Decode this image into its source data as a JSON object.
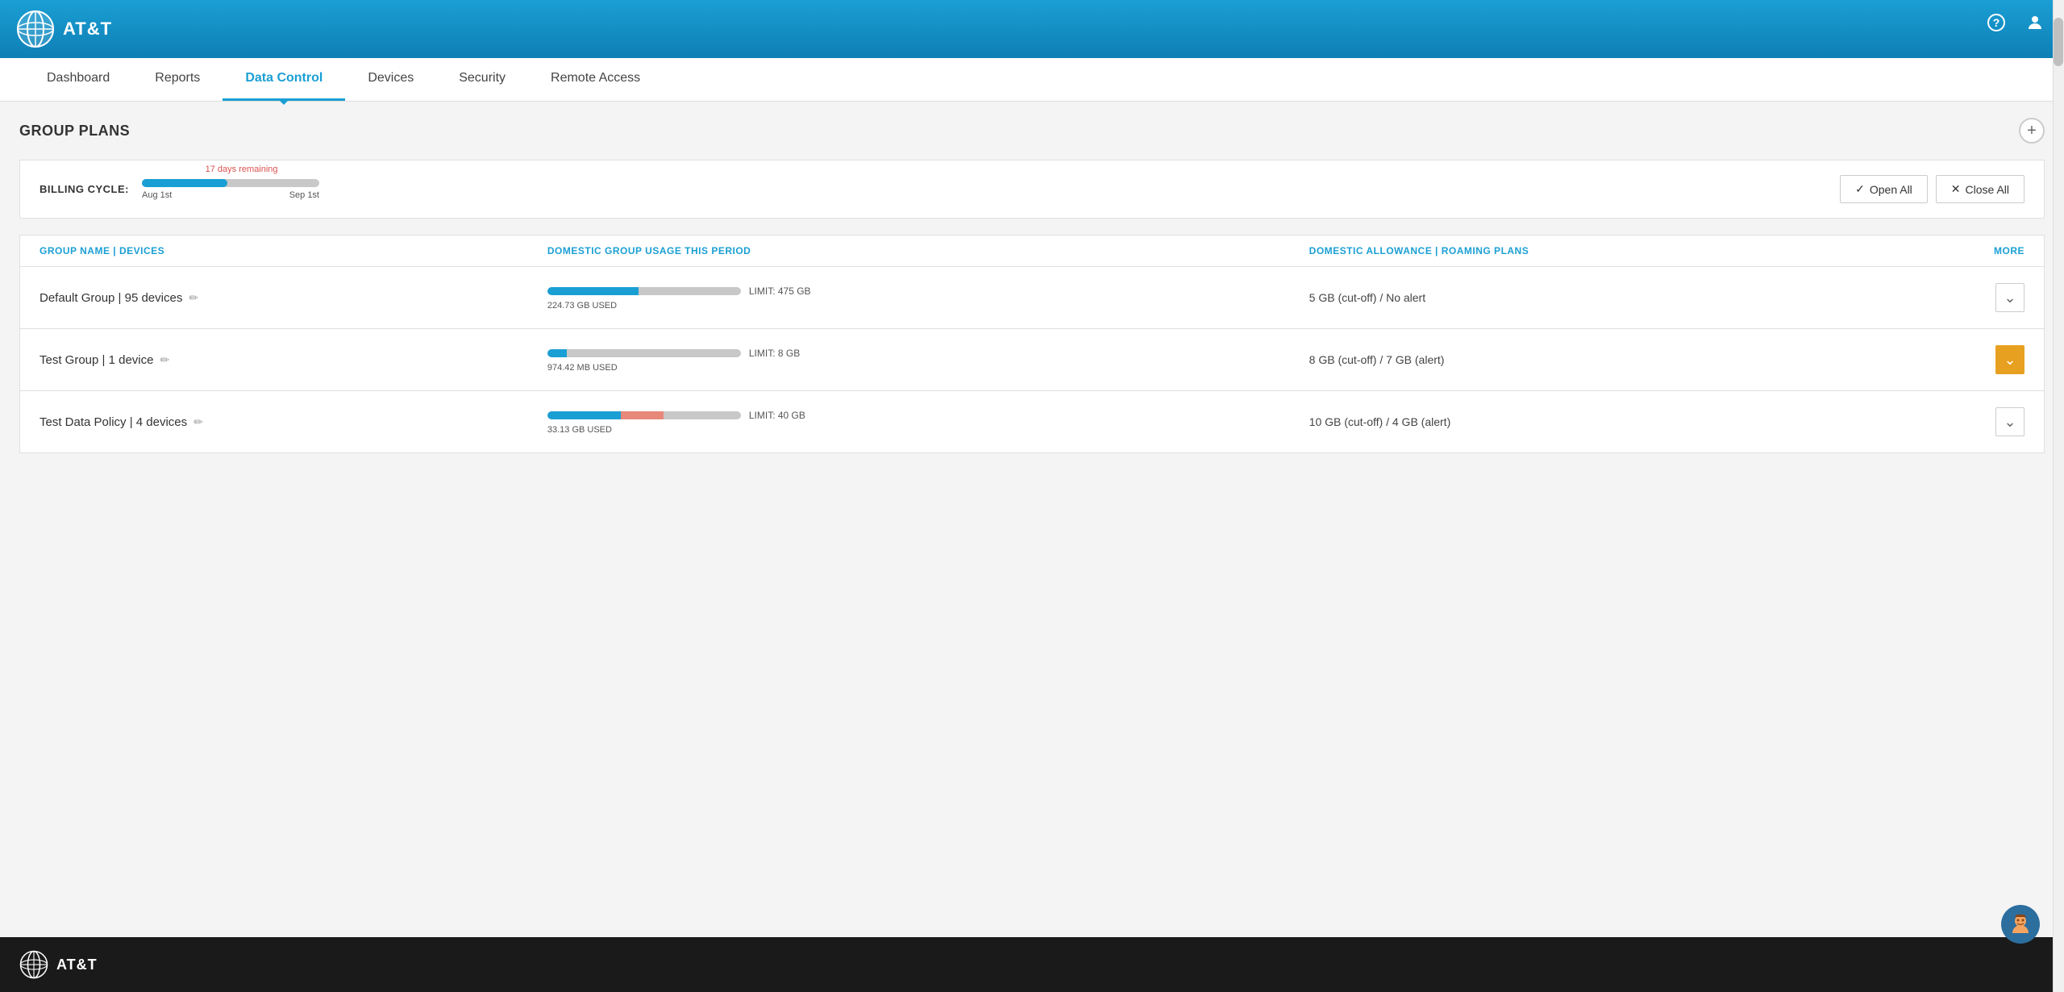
{
  "header": {
    "logo_text": "AT&T",
    "help_icon": "?",
    "user_icon": "👤"
  },
  "nav": {
    "items": [
      {
        "id": "dashboard",
        "label": "Dashboard",
        "active": false
      },
      {
        "id": "reports",
        "label": "Reports",
        "active": false
      },
      {
        "id": "data-control",
        "label": "Data Control",
        "active": true
      },
      {
        "id": "devices",
        "label": "Devices",
        "active": false
      },
      {
        "id": "security",
        "label": "Security",
        "active": false
      },
      {
        "id": "remote-access",
        "label": "Remote Access",
        "active": false
      }
    ]
  },
  "section": {
    "title": "GROUP PLANS",
    "add_button_label": "+"
  },
  "billing": {
    "label": "BILLING CYCLE:",
    "start_date": "Aug 1st",
    "end_date": "Sep 1st",
    "remaining_label": "17 days remaining",
    "fill_percent": 47,
    "open_all_label": "Open All",
    "close_all_label": "Close All",
    "checkmark": "✓",
    "x_mark": "✕"
  },
  "table": {
    "columns": [
      {
        "id": "group-name",
        "label": "GROUP NAME | DEVICES"
      },
      {
        "id": "usage",
        "label": "DOMESTIC GROUP USAGE THIS PERIOD"
      },
      {
        "id": "allowance",
        "label": "DOMESTIC ALLOWANCE | ROAMING PLANS"
      },
      {
        "id": "more",
        "label": "MORE"
      }
    ],
    "rows": [
      {
        "id": "default-group",
        "name": "Default Group | 95 devices",
        "usage_amount": "224.73 GB USED",
        "usage_fill_percent": 47,
        "usage_fill2_percent": 0,
        "limit": "LIMIT: 475 GB",
        "allowance": "5 GB (cut-off) / No alert",
        "expanded": false
      },
      {
        "id": "test-group",
        "name": "Test Group | 1 device",
        "usage_amount": "974.42 MB USED",
        "usage_fill_percent": 10,
        "usage_fill2_percent": 0,
        "limit": "LIMIT: 8 GB",
        "allowance": "8 GB (cut-off) / 7 GB (alert)",
        "expanded": true
      },
      {
        "id": "test-data-policy",
        "name": "Test Data Policy | 4 devices",
        "usage_amount": "33.13 GB USED",
        "usage_fill_percent": 38,
        "usage_fill2_percent": 22,
        "limit": "LIMIT: 40 GB",
        "allowance": "10 GB (cut-off) / 4 GB (alert)",
        "expanded": false
      }
    ]
  },
  "footer": {
    "logo_text": "AT&T"
  },
  "colors": {
    "att_blue": "#1a9fd4",
    "dark_blue": "#0e7fb5",
    "orange": "#e8a020",
    "red_bar": "#e8887a"
  }
}
